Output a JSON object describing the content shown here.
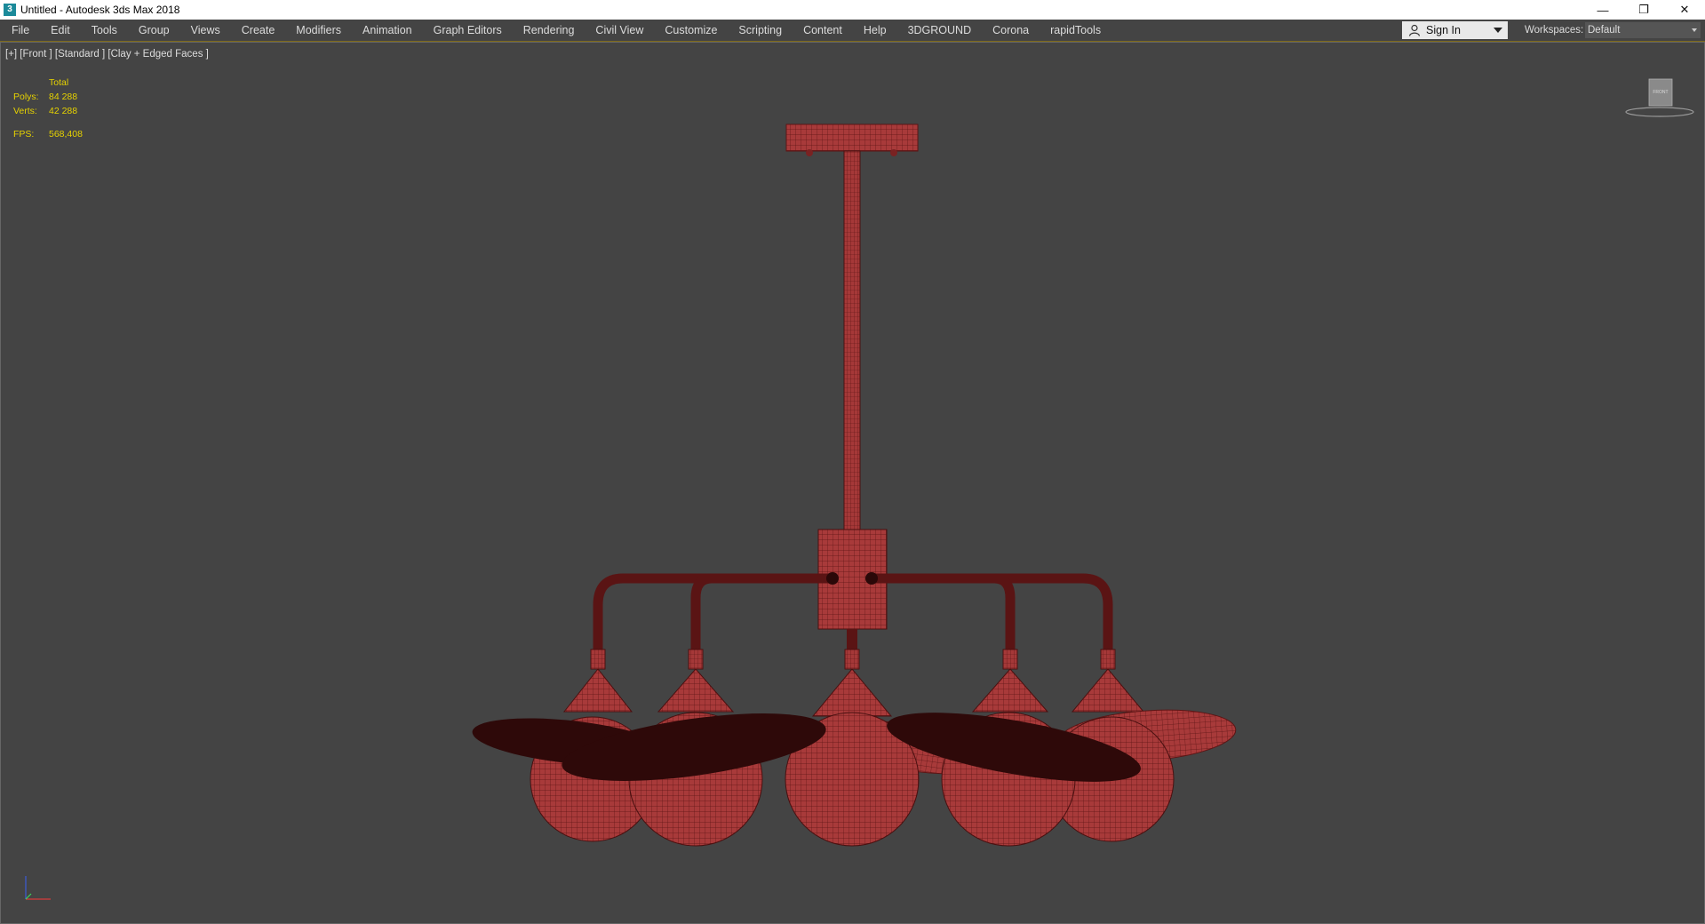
{
  "window": {
    "title": "Untitled - Autodesk 3ds Max 2018",
    "app_icon_glyph": "3",
    "controls": {
      "minimize": "—",
      "restore": "❐",
      "close": "✕"
    }
  },
  "menu": {
    "items": [
      "File",
      "Edit",
      "Tools",
      "Group",
      "Views",
      "Create",
      "Modifiers",
      "Animation",
      "Graph Editors",
      "Rendering",
      "Civil View",
      "Customize",
      "Scripting",
      "Content",
      "Help",
      "3DGROUND",
      "Corona",
      "rapidTools"
    ]
  },
  "signin": {
    "label": "Sign In"
  },
  "workspaces": {
    "label": "Workspaces:",
    "value": "Default"
  },
  "viewport": {
    "label": "[+] [Front ] [Standard ] [Clay + Edged Faces ]",
    "stats": {
      "header": "Total",
      "polys_label": "Polys:",
      "polys_value": "84 288",
      "verts_label": "Verts:",
      "verts_value": "42 288",
      "fps_label": "FPS:",
      "fps_value": "568,408"
    },
    "navcube_label": "FRONT"
  },
  "colors": {
    "background": "#444444",
    "model_fill": "#a83a3a",
    "model_wire": "#5c1515",
    "stats_text": "#e6d200",
    "accent_border": "#7d6a1a"
  }
}
